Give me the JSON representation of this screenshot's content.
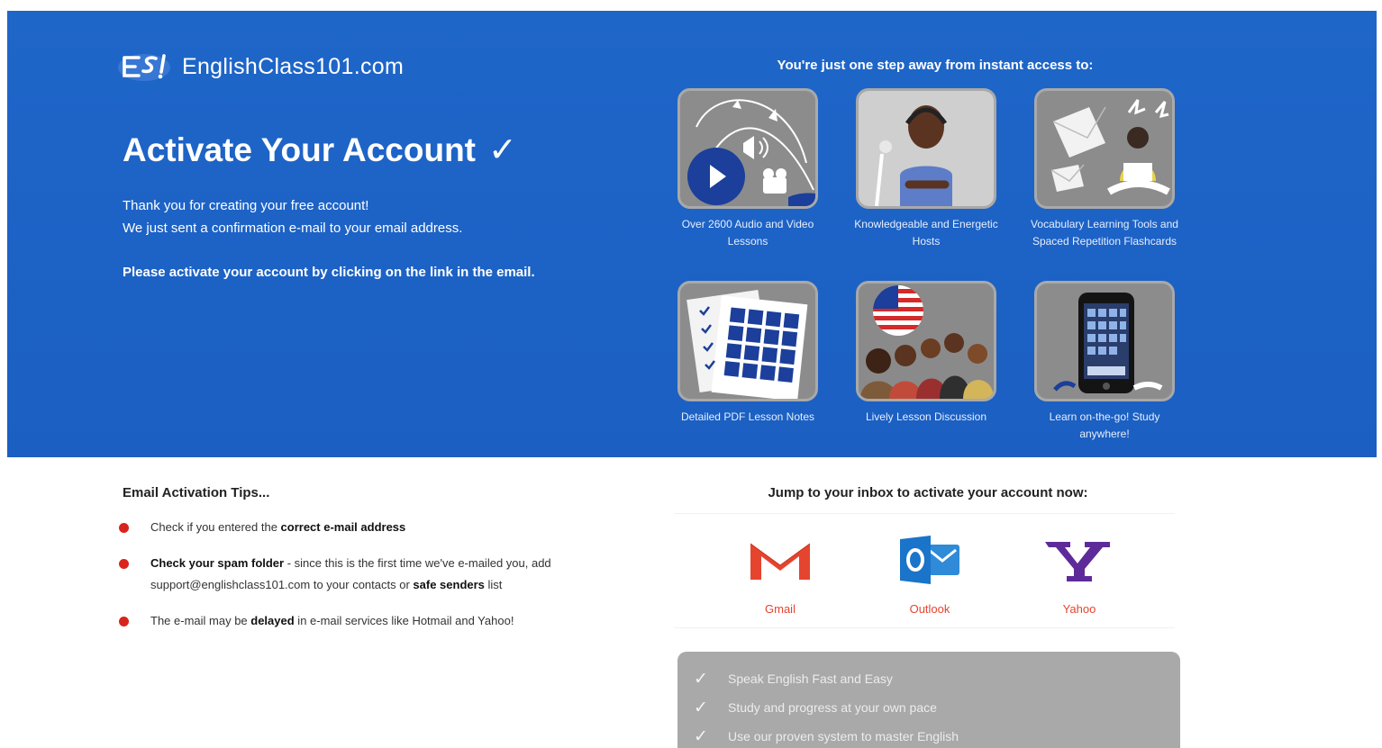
{
  "logo": {
    "mark": "ESL",
    "name": "EnglishClass101.com"
  },
  "hero": {
    "title": "Activate Your Account",
    "title_icon": "✓",
    "intro_line1": "Thank you for creating your free account!",
    "intro_line2": "We just sent a confirmation e-mail to your email address.",
    "instruction": "Please activate your account by clicking on the link in the email."
  },
  "access": {
    "heading": "You're just one step away from instant access to:",
    "features": [
      {
        "icon": "audio-video-lessons-icon",
        "caption": "Over 2600 Audio and Video Lessons"
      },
      {
        "icon": "host-icon",
        "caption": "Knowledgeable and Energetic Hosts"
      },
      {
        "icon": "flashcards-icon",
        "caption": "Vocabulary Learning Tools and Spaced Repetition Flashcards"
      },
      {
        "icon": "pdf-notes-icon",
        "caption": "Detailed PDF Lesson Notes"
      },
      {
        "icon": "discussion-icon",
        "caption": "Lively Lesson Discussion"
      },
      {
        "icon": "mobile-device-icon",
        "caption": "Learn on-the-go! Study anywhere!"
      }
    ]
  },
  "tips": {
    "title": "Email Activation Tips...",
    "item1": {
      "pre": "Check if you entered the ",
      "bold": "correct e-mail address",
      "post": ""
    },
    "item2": {
      "bold": "Check your spam folder",
      "post": " - since this is the first time we've e-mailed you, add support@englishclass101.com to your contacts or ",
      "bold2": "safe senders",
      "post2": " list"
    },
    "item3": {
      "pre": "The e-mail may be ",
      "bold": "delayed",
      "post": " in e-mail services like Hotmail and Yahoo!"
    }
  },
  "inbox": {
    "heading": "Jump to your inbox to activate your account now:",
    "providers": [
      {
        "label": "Gmail",
        "icon": "gmail-icon"
      },
      {
        "label": "Outlook",
        "icon": "outlook-icon"
      },
      {
        "label": "Yahoo",
        "icon": "yahoo-icon"
      }
    ]
  },
  "benefits": {
    "tick": "✓",
    "items": [
      "Speak English Fast and Easy",
      "Study and progress at your own pace",
      "Use our proven system to master English"
    ]
  },
  "colors": {
    "hero_blue": "#1d63c6",
    "bullet_red": "#d9241e",
    "provider_label": "#e5442f",
    "benefits_bg": "#a9a9a9"
  }
}
